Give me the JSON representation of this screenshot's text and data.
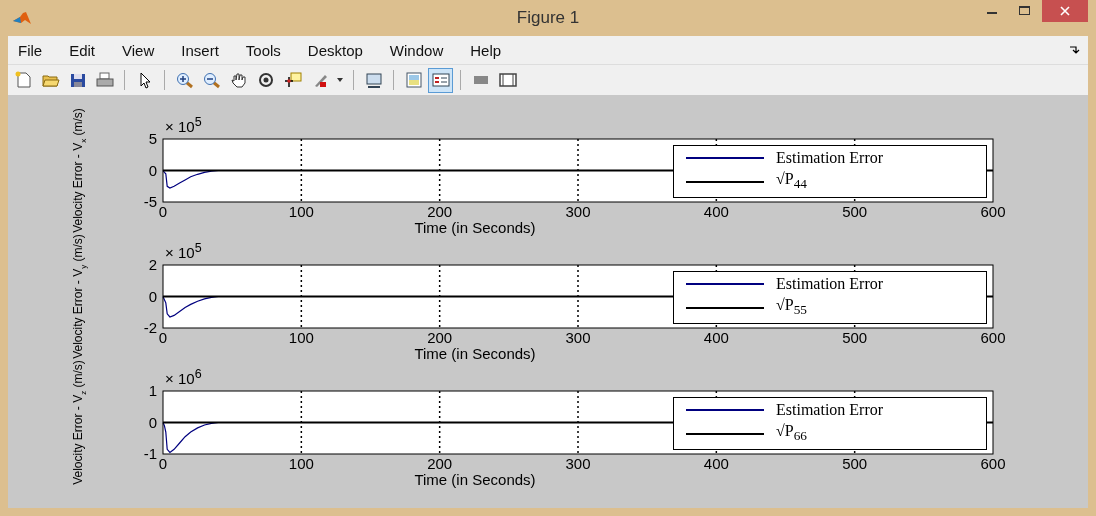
{
  "window": {
    "title": "Figure 1"
  },
  "menu": [
    "File",
    "Edit",
    "View",
    "Insert",
    "Tools",
    "Desktop",
    "Window",
    "Help"
  ],
  "toolbar": [
    {
      "kind": "new",
      "selected": false
    },
    {
      "kind": "open",
      "selected": false
    },
    {
      "kind": "save",
      "selected": false
    },
    {
      "kind": "print",
      "selected": false
    },
    {
      "kind": "sep"
    },
    {
      "kind": "pointer",
      "selected": false
    },
    {
      "kind": "sep"
    },
    {
      "kind": "zoom-in",
      "selected": false
    },
    {
      "kind": "zoom-out",
      "selected": false
    },
    {
      "kind": "pan",
      "selected": false
    },
    {
      "kind": "rotate",
      "selected": false
    },
    {
      "kind": "cursor",
      "selected": false
    },
    {
      "kind": "brush",
      "selected": false
    },
    {
      "kind": "caret"
    },
    {
      "kind": "sep"
    },
    {
      "kind": "link",
      "selected": false
    },
    {
      "kind": "sep"
    },
    {
      "kind": "colorbar",
      "selected": false
    },
    {
      "kind": "legend",
      "selected": true
    },
    {
      "kind": "sep"
    },
    {
      "kind": "hide",
      "selected": false
    },
    {
      "kind": "show",
      "selected": false
    }
  ],
  "subplots": [
    {
      "exponent": "× 10$^{5}$",
      "chart_data": {
        "type": "line",
        "ylabel": "Velocity Error - V$_{x}$ (m/s)",
        "xlabel": "Time (in Seconds)",
        "x": [
          0,
          1,
          2,
          3,
          5,
          8,
          12,
          16,
          20,
          25,
          30,
          35,
          40,
          600
        ],
        "series": [
          {
            "name": "Estimation Error",
            "color": "#00007f",
            "values": [
              0,
              -0.3,
              -0.5,
              -2.5,
              -2.8,
              -2.5,
              -2.0,
              -1.5,
              -1.0,
              -0.6,
              -0.3,
              -0.1,
              0,
              null
            ]
          },
          {
            "name": "√P$_{44}$",
            "color": "#000000",
            "values": [
              0,
              0,
              0,
              0,
              0,
              0,
              0,
              0,
              0,
              0,
              0,
              0,
              0,
              0
            ]
          }
        ],
        "xlim": [
          0,
          600
        ],
        "ylim": [
          -5,
          5
        ],
        "xticks": [
          0,
          100,
          200,
          300,
          400,
          500,
          600
        ],
        "yticks": [
          -5,
          0,
          5
        ]
      }
    },
    {
      "exponent": "× 10$^{5}$",
      "chart_data": {
        "type": "line",
        "ylabel": "Velocity Error - V$_{y}$ (m/s)",
        "xlabel": "Time (in Seconds)",
        "x": [
          0,
          1,
          2,
          3,
          5,
          8,
          12,
          16,
          20,
          25,
          30,
          35,
          40,
          600
        ],
        "series": [
          {
            "name": "Estimation Error",
            "color": "#00007f",
            "values": [
              0,
              -0.2,
              -0.4,
              -1.1,
              -1.3,
              -1.2,
              -0.95,
              -0.7,
              -0.5,
              -0.3,
              -0.15,
              -0.05,
              0,
              null
            ]
          },
          {
            "name": "√P$_{55}$",
            "color": "#000000",
            "values": [
              0,
              0,
              0,
              0,
              0,
              0,
              0,
              0,
              0,
              0,
              0,
              0,
              0,
              0
            ]
          }
        ],
        "xlim": [
          0,
          600
        ],
        "ylim": [
          -2,
          2
        ],
        "xticks": [
          0,
          100,
          200,
          300,
          400,
          500,
          600
        ],
        "yticks": [
          -2,
          0,
          2
        ]
      }
    },
    {
      "exponent": "× 10$^{6}$",
      "chart_data": {
        "type": "line",
        "ylabel": "Velocity Error - V$_{z}$ (m/s)",
        "xlabel": "Time (in Seconds)",
        "x": [
          0,
          1,
          2,
          3,
          5,
          8,
          12,
          16,
          20,
          25,
          30,
          35,
          40,
          600
        ],
        "series": [
          {
            "name": "Estimation Error",
            "color": "#00007f",
            "values": [
              0,
              -0.1,
              -0.3,
              -0.85,
              -0.95,
              -0.85,
              -0.65,
              -0.45,
              -0.3,
              -0.17,
              -0.08,
              -0.03,
              0,
              null
            ]
          },
          {
            "name": "√P$_{66}$",
            "color": "#000000",
            "values": [
              0,
              0,
              0,
              0,
              0,
              0,
              0,
              0,
              0,
              0,
              0,
              0,
              0,
              0
            ]
          }
        ],
        "xlim": [
          0,
          600
        ],
        "ylim": [
          -1,
          1
        ],
        "xticks": [
          0,
          100,
          200,
          300,
          400,
          500,
          600
        ],
        "yticks": [
          -1,
          0,
          1
        ]
      }
    }
  ]
}
